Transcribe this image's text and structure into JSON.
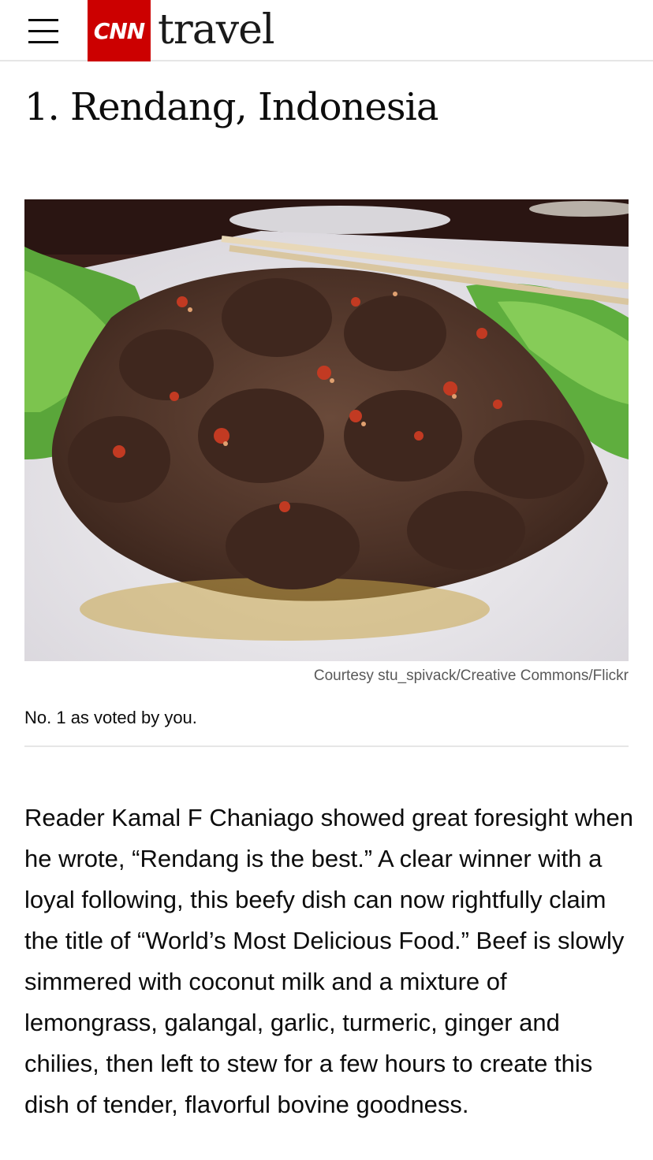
{
  "header": {
    "menu_icon": "hamburger-menu-icon",
    "logo_text": "CNN",
    "section_name": "travel",
    "brand_color": "#cc0000"
  },
  "article": {
    "headline": "1. Rendang, Indonesia",
    "image_credit": "Courtesy stu_spivack/Creative Commons/Flickr",
    "caption": "No. 1 as voted by you.",
    "body": "Reader Kamal F Chaniago showed great foresight when he wrote, “Rendang is the best.” A clear winner with a loyal following, this beefy dish can now rightfully claim the title of “World’s Most Delicious Food.” Beef is slowly simmered with coconut milk and a mixture of lemongrass, galangal, garlic, turmeric, ginger and chilies, then left to stew for a few hours to create this dish of tender, flavorful bovine goodness."
  }
}
